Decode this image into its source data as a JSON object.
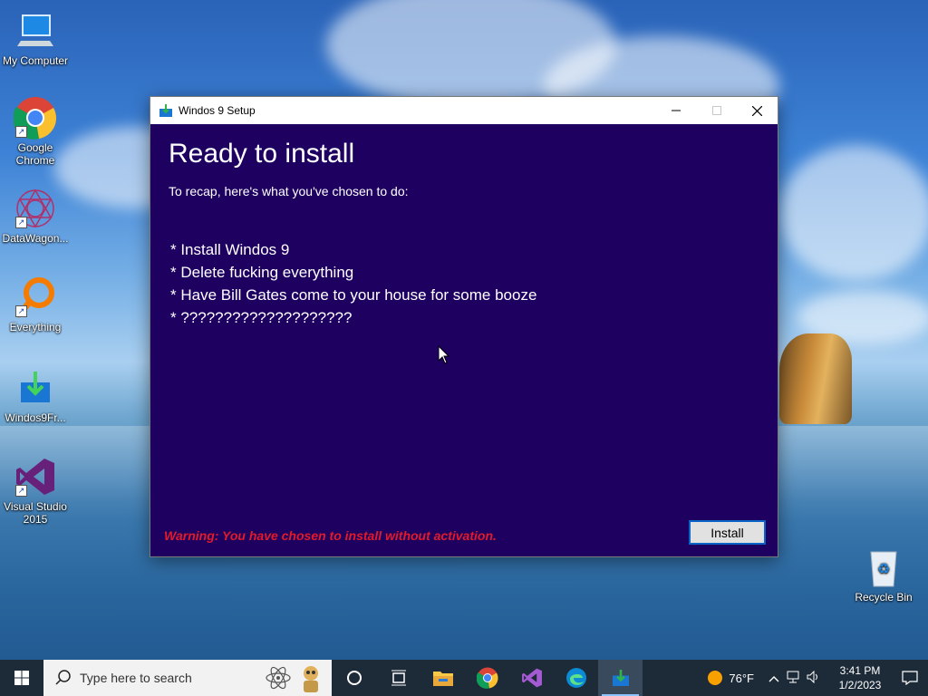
{
  "desktop": {
    "icons": [
      {
        "label": "My Computer"
      },
      {
        "label": "Google Chrome"
      },
      {
        "label": "DataWagon..."
      },
      {
        "label": "Everything"
      },
      {
        "label": "Windos9Fr..."
      },
      {
        "label": "Visual Studio 2015"
      },
      {
        "label": "Recycle Bin"
      }
    ]
  },
  "window": {
    "title": "Windos 9 Setup",
    "heading": "Ready to install",
    "subtitle": "To recap, here's what you've chosen to do:",
    "items": [
      "* Install Windos 9",
      "* Delete fucking everything",
      "* Have Bill Gates come to your house for some booze",
      "* ????????????????????"
    ],
    "warning": "Warning: You have chosen to install without activation.",
    "install_label": "Install",
    "controls": {
      "minimize": "minimize-icon",
      "maximize": "maximize-icon",
      "close": "close-icon"
    }
  },
  "taskbar": {
    "search_placeholder": "Type here to search",
    "apps": [
      "task-view",
      "file-explorer",
      "google-chrome",
      "visual-studio",
      "microsoft-edge",
      "windos9-setup"
    ],
    "weather": "76°F",
    "time": "3:41 PM",
    "date": "1/2/2023"
  },
  "colors": {
    "dialog_bg": "#1d0060",
    "warning": "#e21a2a",
    "button_border": "#0a64c8",
    "taskbar": "#1d2a38"
  }
}
